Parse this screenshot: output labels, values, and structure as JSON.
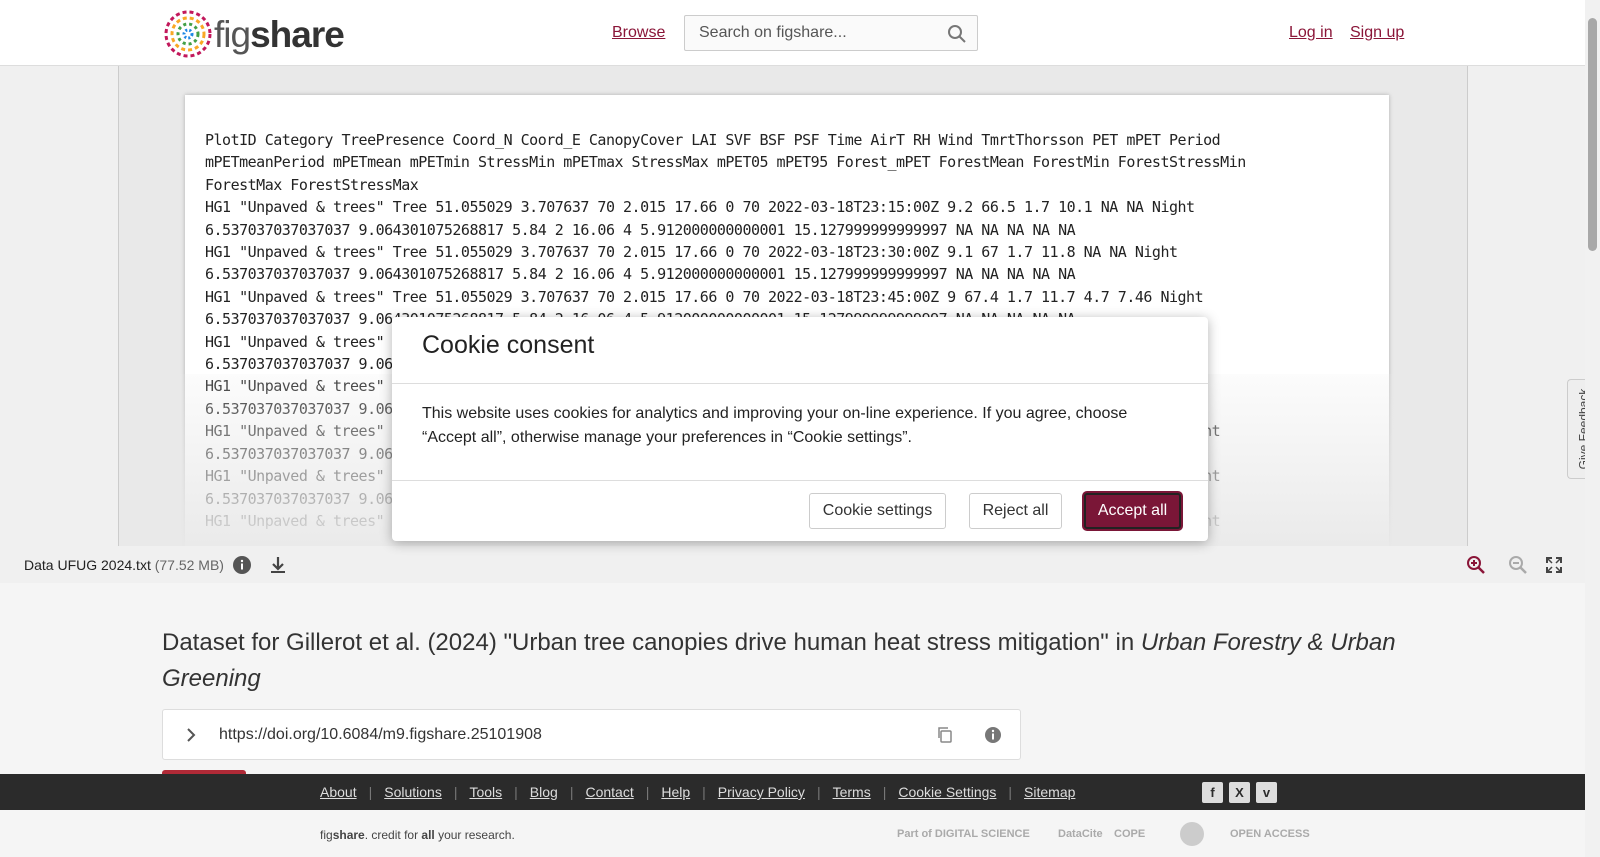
{
  "header": {
    "logo_text_light": "fig",
    "logo_text_bold": "share",
    "browse_label": "Browse",
    "search_placeholder": "Search on figshare...",
    "login_label": "Log in",
    "signup_label": "Sign up"
  },
  "viewer": {
    "lines": [
      "PlotID Category TreePresence Coord_N Coord_E CanopyCover LAI SVF BSF PSF Time AirT RH Wind TmrtThorsson PET mPET Period",
      "mPETmeanPeriod mPETmean mPETmin StressMin mPETmax StressMax mPET05 mPET95 Forest_mPET ForestMean ForestMin ForestStressMin",
      "ForestMax ForestStressMax",
      "HG1 \"Unpaved & trees\" Tree 51.055029 3.707637 70 2.015 17.66 0 70 2022-03-18T23:15:00Z 9.2 66.5 1.7 10.1 NA NA Night",
      "6.537037037037037 9.064301075268817 5.84 2 16.06 4 5.912000000000001 15.127999999999997 NA NA NA NA NA",
      "HG1 \"Unpaved & trees\" Tree 51.055029 3.707637 70 2.015 17.66 0 70 2022-03-18T23:30:00Z 9.1 67 1.7 11.8 NA NA Night",
      "6.537037037037037 9.064301075268817 5.84 2 16.06 4 5.912000000000001 15.127999999999997 NA NA NA NA NA",
      "HG1 \"Unpaved & trees\" Tree 51.055029 3.707637 70 2.015 17.66 0 70 2022-03-18T23:45:00Z 9 67.4 1.7 11.7 4.7 7.46 Night",
      "6.537037037037037 9.064301075268817 5.84 2 16.06 4 5.912000000000001 15.127999999999997 NA NA NA NA NA",
      "HG1 \"Unpaved & trees\" Tree 51.055029 3.707637 70 2.015 17.66 0 70 2022-03-19T00:00:00Z 9 67.6 1.7 11.7 4.6 7.34 Night",
      "6.537037037037037 9.064301075268817 5.84 2 16.06 4 5.912000000000001 15.127999999999997 NA NA NA NA NA",
      "HG1 \"Unpaved & trees\" Tree 51.055029 3.707637 70 2.015 17.66 0 70 2022-03-19T00:15:00Z 8.9 68 1.7 11.6 4.5 7.08 Night",
      "6.537037037037037 9.064301075268817 5.84 2 16.06 4 5.912000000000001 15.127999999999997 NA NA NA NA NA",
      "HG1 \"Unpaved & trees\" Tree 51.055029 3.707637 70 2.015 17.66 0 70 2022-03-19T00:30:00Z 8.8 68.4 1.7 11.5 4.4 6.86 Night",
      "6.537037037037037 9.064301075268817 5.84 2 16.06 4 5.912000000000001 15.127999999999997 NA NA NA NA NA",
      "HG1 \"Unpaved & trees\" Tree 51.055029 3.707637 70 2.015 17.66 0 70 2022-03-19T00:45:00Z 8.7 68.8 1.7 11.4 4.3 6.62 Night",
      "6.537037037037037 9.064301075268817 5.84 2 16.06 4 5.912000000000001 15.127999999999997 NA NA NA NA NA",
      "HG1 \"Unpaved & trees\" Tree 51.055029 3.707637 70 2.015 17.66 0 70 2022-03-19T01:00:00Z 8.6 69.2 1.7 11.3 4.2 6.40 Night"
    ]
  },
  "feedback": {
    "label": "Give Feedback"
  },
  "toolbar": {
    "file_name": "Data UFUG 2024.txt",
    "file_size": "(77.52 MB)"
  },
  "main": {
    "title_plain": "Dataset for Gillerot et al. (2024) \"Urban tree canopies drive human heat stress mitigation\" in ",
    "title_italic": "Urban Forestry & Urban Greening",
    "doi": "https://doi.org/10.6084/m9.figshare.25101908"
  },
  "footer": {
    "links": [
      "About",
      "Solutions",
      "Tools",
      "Blog",
      "Contact",
      "Help",
      "Privacy Policy",
      "Terms",
      "Cookie Settings",
      "Sitemap"
    ],
    "tagline_pre": "fig",
    "tagline_bold": "share",
    "tagline_mid": ". credit for ",
    "tagline_all": "all",
    "tagline_post": " your research.",
    "partners": [
      "Part of DIGITAL SCIENCE",
      "DataCite",
      "COPE",
      "",
      "OPEN ACCESS"
    ]
  },
  "modal": {
    "title": "Cookie consent",
    "body": "This website uses cookies for analytics and improving your on-line experience. If you agree, choose “Accept all”, otherwise manage your preferences in “Cookie settings”.",
    "settings_label": "Cookie settings",
    "reject_label": "Reject all",
    "accept_label": "Accept all"
  },
  "colors": {
    "brand": "#8a1538",
    "accept": "#7a1637",
    "footer_bg": "#2b2b2b"
  }
}
